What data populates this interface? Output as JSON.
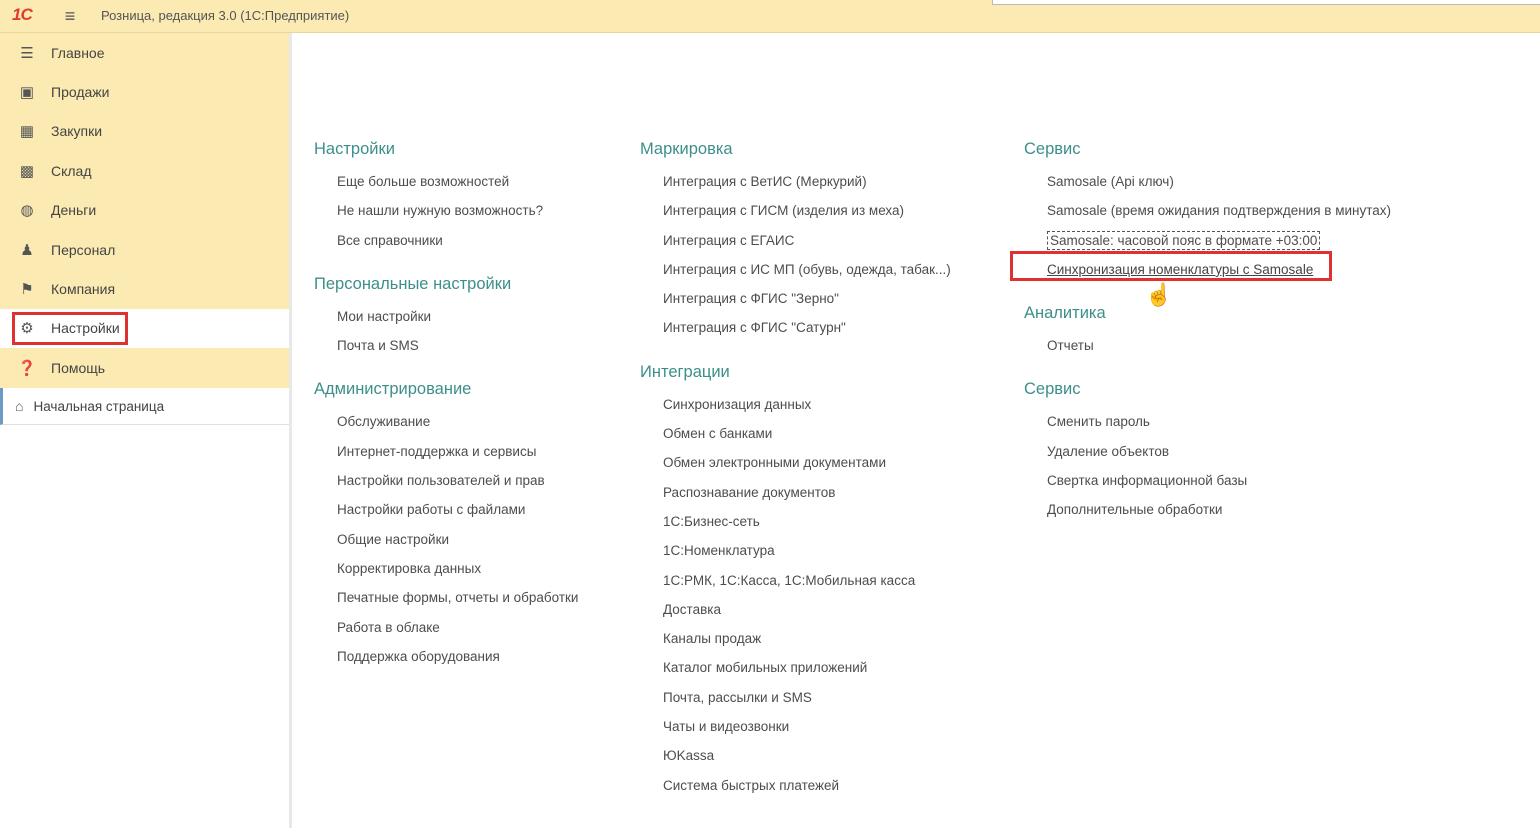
{
  "titlebar": {
    "logo": "1С",
    "title": "Розница, редакция 3.0  (1С:Предприятие)"
  },
  "sidebar": {
    "items": [
      {
        "label": "Главное",
        "icon": "☰"
      },
      {
        "label": "Продажи",
        "icon": "▣"
      },
      {
        "label": "Закупки",
        "icon": "▦"
      },
      {
        "label": "Склад",
        "icon": "▩"
      },
      {
        "label": "Деньги",
        "icon": "◍"
      },
      {
        "label": "Персонал",
        "icon": "♟"
      },
      {
        "label": "Компания",
        "icon": "⚑"
      },
      {
        "label": "Настройки",
        "icon": "⚙"
      },
      {
        "label": "Помощь",
        "icon": "❓"
      }
    ],
    "homepage": {
      "label": "Начальная страница",
      "icon": "⌂"
    }
  },
  "columns": [
    {
      "sections": [
        {
          "title": "Настройки",
          "links": [
            "Еще больше возможностей",
            "Не нашли нужную возможность?",
            "Все справочники"
          ]
        },
        {
          "title": "Персональные настройки",
          "links": [
            "Мои настройки",
            "Почта и SMS"
          ]
        },
        {
          "title": "Администрирование",
          "links": [
            "Обслуживание",
            "Интернет-поддержка и сервисы",
            "Настройки пользователей и прав",
            "Настройки работы с файлами",
            "Общие настройки",
            "Корректировка данных",
            "Печатные формы, отчеты и обработки",
            "Работа в облаке",
            "Поддержка оборудования"
          ]
        }
      ]
    },
    {
      "sections": [
        {
          "title": "Маркировка",
          "links": [
            "Интеграция с ВетИС (Меркурий)",
            "Интеграция с ГИСМ (изделия из меха)",
            "Интеграция с ЕГАИС",
            "Интеграция с ИС МП (обувь, одежда, табак...)",
            "Интеграция с ФГИС \"Зерно\"",
            "Интеграция с ФГИС \"Сатурн\""
          ]
        },
        {
          "title": "Интеграции",
          "links": [
            "Синхронизация данных",
            "Обмен с банками",
            "Обмен электронными документами",
            "Распознавание документов",
            "1С:Бизнес-сеть",
            "1С:Номенклатура",
            "1С:РМК, 1С:Касса, 1С:Мобильная касса",
            "Доставка",
            "Каналы продаж",
            "Каталог мобильных приложений",
            "Почта, рассылки и SMS",
            "Чаты и видеозвонки",
            "ЮKassa",
            "Система быстрых платежей"
          ]
        }
      ]
    },
    {
      "sections": [
        {
          "title": "Сервис",
          "links": [
            "Samosale (Api ключ)",
            "Samosale (время ожидания подтверждения в минутах)",
            "Samosale: часовой пояс в формате +03:00",
            "Синхронизация номенклатуры с Samosale"
          ]
        },
        {
          "title": "Аналитика",
          "links": [
            "Отчеты"
          ]
        },
        {
          "title": "Сервис",
          "links": [
            "Сменить пароль",
            "Удаление объектов",
            "Свертка информационной базы",
            "Дополнительные обработки"
          ]
        }
      ]
    }
  ]
}
